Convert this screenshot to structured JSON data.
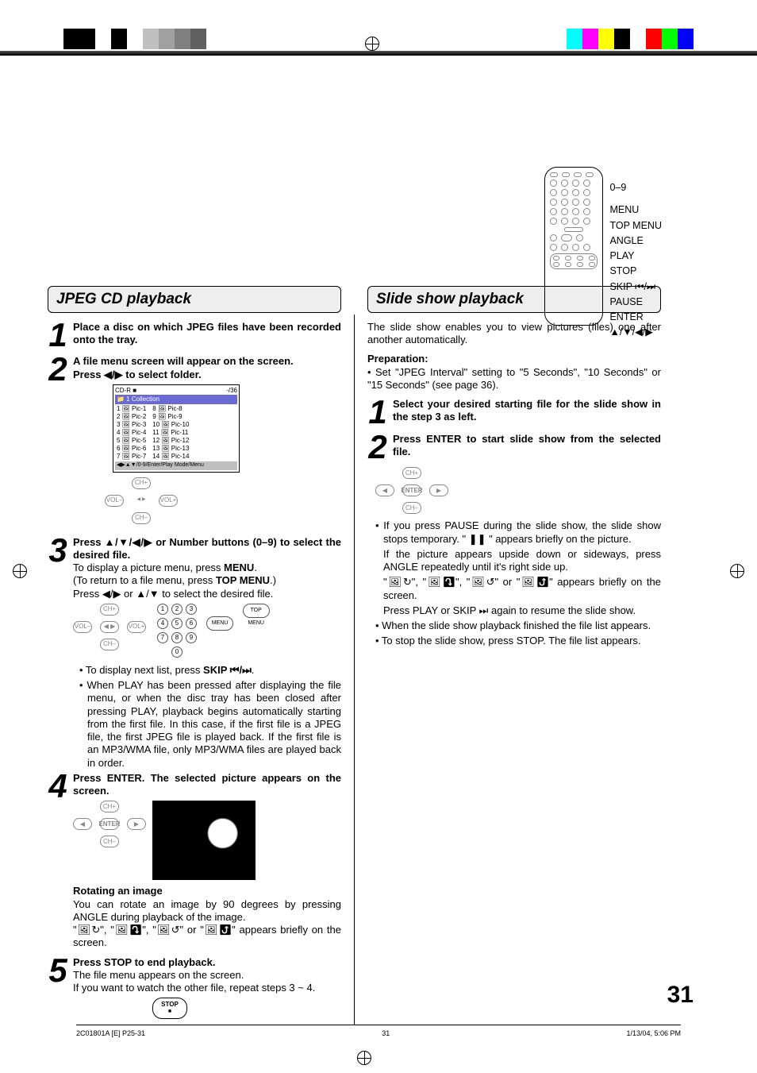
{
  "remote": {
    "l0": "0–9",
    "l1": "MENU",
    "l2": "TOP MENU",
    "l3": "ANGLE",
    "l4": "PLAY",
    "l5": "STOP",
    "l6": "SKIP ⏮/⏭",
    "l7": "PAUSE",
    "l8": "ENTER",
    "l9": "▲/▼/◀/▶"
  },
  "left": {
    "title": "JPEG CD playback",
    "step1": "Place a disc on which JPEG files have been recorded onto the tray.",
    "step2a": "A file menu screen will appear on the screen.",
    "step2b": "Press ◀/▶ to select folder.",
    "screen": {
      "top": "CD-R ■",
      "count": "-/36",
      "folder": "📁 1 Collection",
      "filesL": [
        "1  🖼 Pic-1",
        "2  🖼 Pic-2",
        "3  🖼 Pic-3",
        "4  🖼 Pic-4",
        "5  🖼 Pic-5",
        "6  🖼 Pic-6",
        "7  🖼 Pic-7"
      ],
      "filesR": [
        "8  🖼 Pic-8",
        "9  🖼 Pic-9",
        "10 🖼 Pic-10",
        "11 🖼 Pic-11",
        "12 🖼 Pic-12",
        "13 🖼 Pic-13",
        "14 🖼 Pic-14"
      ],
      "footer": "◀▶▲▼/0-9/Enter/Play Mode/Menu"
    },
    "step3a": "Press ▲/▼/◀/▶ or Number buttons (0–9) to select the desired file.",
    "step3b_pre": "To display a picture menu, press ",
    "step3b_bold": "MENU",
    "step3b_post": ".",
    "step3c_pre": "(To return to a file menu, press ",
    "step3c_bold": "TOP MENU",
    "step3c_post": ".)",
    "step3d": "Press ◀/▶ or ▲/▼ to select the desired file.",
    "bul1_pre": "• To display next list, press ",
    "bul1_bold": "SKIP ⏮/⏭",
    "bul1_post": ".",
    "bul2": "• When PLAY has been pressed after displaying the file menu, or when the disc tray has been closed after pressing PLAY, playback begins automatically starting from the first file. In this case, if the first file is a JPEG file, the first JPEG file is played back. If the first file is an MP3/WMA file, only MP3/WMA files are played back in order.",
    "step4": "Press ENTER. The selected picture appears on the screen.",
    "rot_h": "Rotating an image",
    "rot_a": "You can rotate an image by 90 degrees by pressing ANGLE during playback of the image.",
    "rot_b": "\"🖼↻\", \"🖼⤵\", \"🖼↺\" or \"🖼⤴\" appears briefly on the screen.",
    "step5a": "Press STOP to end playback.",
    "step5b": "The file menu appears on the screen.",
    "step5c": "If you want to watch the other file, repeat steps 3 ~ 4.",
    "stopbtn": "STOP"
  },
  "menubtn1": "MENU",
  "menubtn2": "TOP MENU",
  "nav": {
    "chp": "CH+",
    "chm": "CH–",
    "volm": "VOL–",
    "volp": "VOL+",
    "enter": "ENTER"
  },
  "right": {
    "title": "Slide show playback",
    "intro": "The slide show enables you to view pictures (files) one after another automatically.",
    "prep_h": "Preparation:",
    "prep": "• Set \"JPEG Interval\" setting to \"5 Seconds\", \"10 Seconds\" or \"15 Seconds\" (see page 36).",
    "s1": "Select your desired starting file for the slide show in the step 3 as left.",
    "s2": "Press ENTER to start slide show from the selected file.",
    "b1": "• If you press PAUSE during the slide show, the slide show stops temporary. \" ❚❚ \" appears briefly on the picture.",
    "b2": "If the picture appears upside down or sideways, press ANGLE repeatedly until it's right side up.",
    "b3": "\"🖼↻\", \"🖼⤵\", \"🖼↺\" or \"🖼⤴\" appears briefly on the screen.",
    "b4": "Press PLAY or SKIP ⏭ again to resume the slide show.",
    "b5": "• When the slide show playback finished the file list appears.",
    "b6": "• To stop the slide show, press STOP. The file list appears."
  },
  "page_number": "31",
  "footer": {
    "left": "2C01801A [E] P25-31",
    "center": "31",
    "right": "1/13/04, 5:06 PM"
  }
}
